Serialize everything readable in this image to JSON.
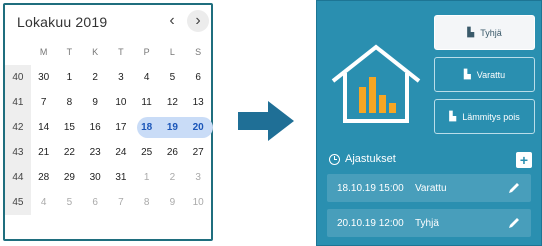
{
  "calendar": {
    "title": "Lokakuu 2019",
    "dow": [
      "M",
      "T",
      "K",
      "T",
      "P",
      "L",
      "S"
    ],
    "weeks": [
      {
        "num": "40",
        "days": [
          "30",
          "1",
          "2",
          "3",
          "4",
          "5",
          "6"
        ]
      },
      {
        "num": "41",
        "days": [
          "7",
          "8",
          "9",
          "10",
          "11",
          "12",
          "13"
        ]
      },
      {
        "num": "42",
        "days": [
          "14",
          "15",
          "16",
          "17",
          "18",
          "19",
          "20"
        ]
      },
      {
        "num": "43",
        "days": [
          "21",
          "22",
          "23",
          "24",
          "25",
          "26",
          "27"
        ]
      },
      {
        "num": "44",
        "days": [
          "28",
          "29",
          "30",
          "31",
          "1",
          "2",
          "3"
        ]
      },
      {
        "num": "45",
        "days": [
          "4",
          "5",
          "6",
          "7",
          "8",
          "9",
          "10"
        ]
      }
    ],
    "selected_range": [
      "18",
      "19",
      "20"
    ]
  },
  "icons": {
    "prev": "chevron-left-icon",
    "next": "chevron-right-icon",
    "arrow": "arrow-right-icon",
    "house": "house-chart-icon",
    "clock": "clock-icon",
    "edit": "pencil-icon"
  },
  "colors": {
    "panel": "#2a8fb0",
    "accent_orange": "#f6a623",
    "range_highlight": "#c9dcf7",
    "arrow": "#1f6f96"
  },
  "panel": {
    "modes": [
      "Tyhjä",
      "Varattu",
      "Lämmitys pois"
    ],
    "schedule_title": "Ajastukset",
    "add_label": "+",
    "items": [
      {
        "date": "18.10.19 15:00",
        "status": "Varattu"
      },
      {
        "date": "20.10.19 12:00",
        "status": "Tyhjä"
      }
    ]
  }
}
